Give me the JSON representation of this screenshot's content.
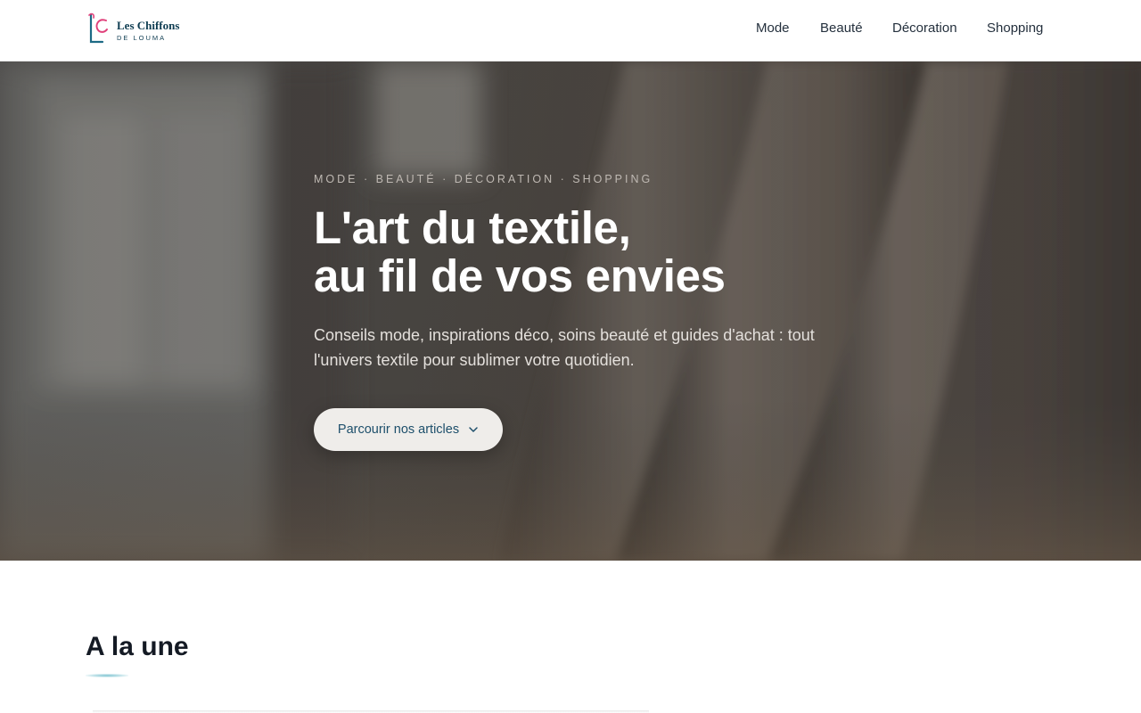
{
  "brand": {
    "name": "Les Chiffons",
    "tagline": "DE LOUMA"
  },
  "nav": {
    "items": [
      {
        "label": "Mode"
      },
      {
        "label": "Beauté"
      },
      {
        "label": "Décoration"
      },
      {
        "label": "Shopping"
      }
    ]
  },
  "hero": {
    "kicker": "MODE · BEAUTÉ · DÉCORATION · SHOPPING",
    "title_line1": "L'art du textile,",
    "title_line2": "au fil de vos envies",
    "description": "Conseils mode, inspirations déco, soins beauté et guides d'achat : tout l'univers textile pour sublimer votre quotidien.",
    "cta_label": "Parcourir nos articles",
    "cta_icon": "chevron-down-icon"
  },
  "featured": {
    "title": "A la une"
  },
  "colors": {
    "brand_teal": "#0f3d52",
    "brand_pink": "#e0407a",
    "cta_text": "#1d4f6b",
    "accent": "#7fc4d1"
  }
}
